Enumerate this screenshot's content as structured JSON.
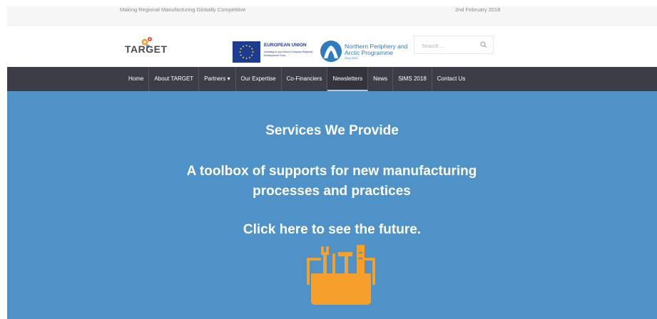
{
  "topbar": {
    "tagline": "Making Regional Manufacturing Globally Competitive",
    "date": "2nd February 2018"
  },
  "header": {
    "logo_text": "TARGET",
    "eu": {
      "title": "EUROPEAN UNION",
      "subtitle": "Investing in your future European Regional Development Fund"
    },
    "npa": {
      "title": "Northern Periphery and Arctic Programme",
      "years": "2014-2020"
    },
    "search": {
      "placeholder": "Search ..."
    }
  },
  "nav": {
    "items": [
      {
        "label": "Home"
      },
      {
        "label": "About TARGET"
      },
      {
        "label": "Partners ▾"
      },
      {
        "label": "Our Expertise"
      },
      {
        "label": "Co-Financiers"
      },
      {
        "label": "Newsletters"
      },
      {
        "label": "News"
      },
      {
        "label": "SIMS 2018"
      },
      {
        "label": "Contact Us"
      }
    ]
  },
  "hero": {
    "title": "Services We Provide",
    "subtitle": "A toolbox of supports for new manufacturing processes and practices",
    "cta": "Click here to see the future.",
    "icon": "toolbox-icon"
  },
  "colors": {
    "nav_bg": "#3d3d47",
    "hero_bg": "#4f92c7",
    "accent_orange": "#f5a02a",
    "eu_blue": "#1d3c8f",
    "npa_blue": "#2d7bc0"
  }
}
